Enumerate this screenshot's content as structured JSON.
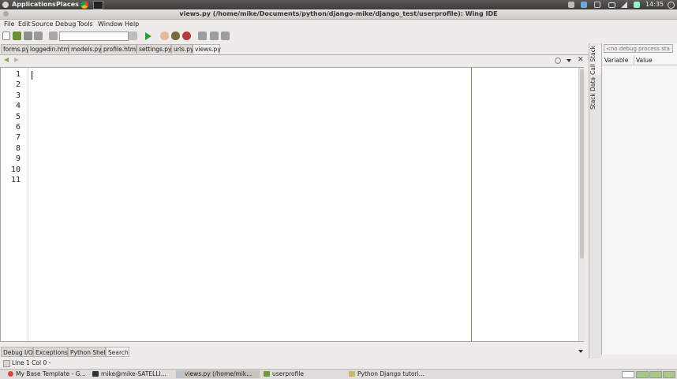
{
  "panel": {
    "applications": "Applications",
    "places": "Places",
    "clock": "14:35"
  },
  "window": {
    "title": "views.py (/home/mike/Documents/python/django-mike/django_test/userprofile): Wing IDE"
  },
  "menu": [
    "File",
    "Edit",
    "Source",
    "Debug",
    "Tools",
    "Window",
    "Help"
  ],
  "file_tabs": [
    "forms.py",
    "loggedin.html",
    "models.py",
    "profile.html",
    "settings.py",
    "urls.py",
    "views.py"
  ],
  "active_tab": "views.py",
  "editor": {
    "line_numbers": [
      "1",
      "2",
      "3",
      "4",
      "5",
      "6",
      "7",
      "8",
      "9",
      "10",
      "11"
    ]
  },
  "side_tabs": [
    "Call Stack",
    "Stack Data"
  ],
  "debug_panel": {
    "process_select": "<no debug process sta",
    "col_variable": "Variable",
    "col_value": "Value"
  },
  "bottom_tabs": [
    "Debug I/O",
    "Exceptions",
    "Python Shell",
    "Search"
  ],
  "status": "Line 1 Col 0 -",
  "taskbar": [
    "My Base Template - G...",
    "mike@mike-SATELLI...",
    "views.py (/home/mik...",
    "userprofile",
    "Python Django tutori..."
  ],
  "colors": {
    "edge_line": "#e06060",
    "run_green": "#2e9c2e"
  }
}
